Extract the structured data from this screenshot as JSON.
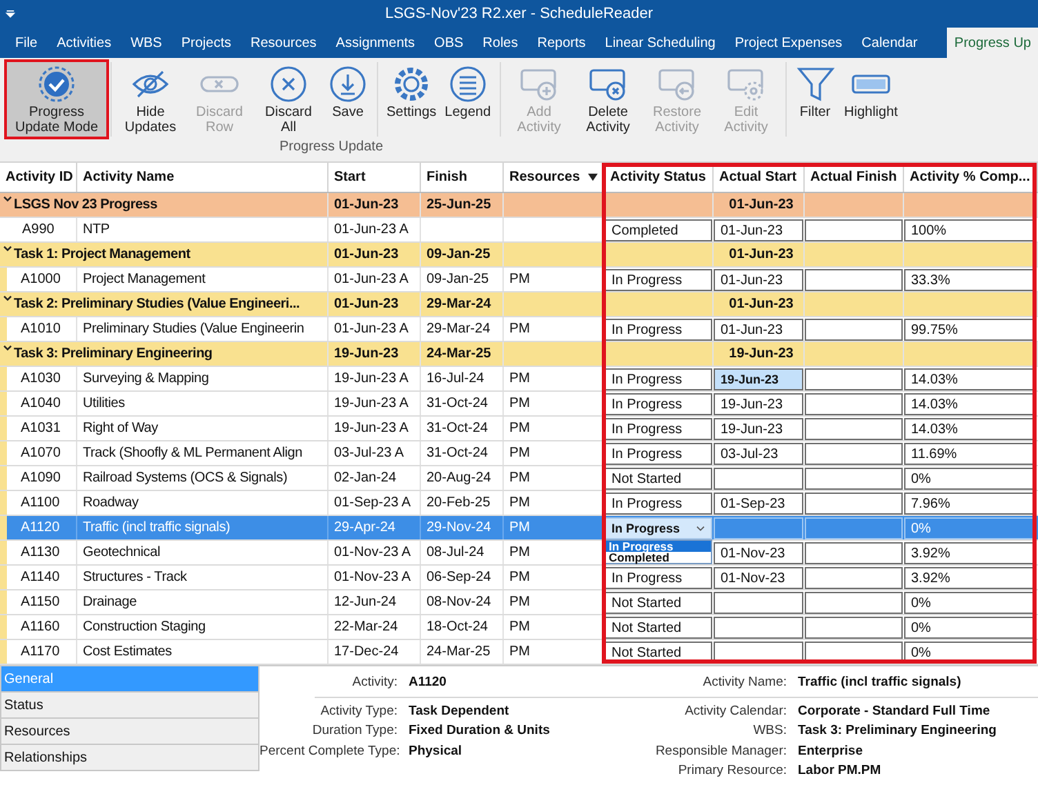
{
  "window": {
    "title": "LSGS-Nov'23 R2.xer - ScheduleReader"
  },
  "menu": [
    {
      "label": "File",
      "selected": false
    },
    {
      "label": "Activities",
      "selected": false
    },
    {
      "label": "WBS",
      "selected": false
    },
    {
      "label": "Projects",
      "selected": false
    },
    {
      "label": "Resources",
      "selected": false
    },
    {
      "label": "Assignments",
      "selected": false
    },
    {
      "label": "OBS",
      "selected": false
    },
    {
      "label": "Roles",
      "selected": false
    },
    {
      "label": "Reports",
      "selected": false
    },
    {
      "label": "Linear Scheduling",
      "selected": false
    },
    {
      "label": "Project Expenses",
      "selected": false
    },
    {
      "label": "Calendar",
      "selected": false
    },
    {
      "label": "Progress Up",
      "selected": true
    }
  ],
  "ribbon": {
    "caption": "Progress Update",
    "groups": [
      {
        "buttons": [
          {
            "label": "Progress Update Mode",
            "selected": true,
            "disabled": false
          }
        ]
      },
      {
        "buttons": [
          {
            "label": "Hide Updates",
            "selected": false,
            "disabled": false
          },
          {
            "label": "Discard Row",
            "selected": false,
            "disabled": true
          },
          {
            "label": "Discard All",
            "selected": false,
            "disabled": false
          },
          {
            "label": "Save",
            "selected": false,
            "disabled": false
          }
        ]
      },
      {
        "buttons": [
          {
            "label": "Settings",
            "selected": false,
            "disabled": false
          },
          {
            "label": "Legend",
            "selected": false,
            "disabled": false
          }
        ]
      },
      {
        "buttons": [
          {
            "label": "Add Activity",
            "selected": false,
            "disabled": true
          },
          {
            "label": "Delete Activity",
            "selected": false,
            "disabled": false
          },
          {
            "label": "Restore Activity",
            "selected": false,
            "disabled": true
          },
          {
            "label": "Edit Activity",
            "selected": false,
            "disabled": true
          }
        ]
      },
      {
        "buttons": [
          {
            "label": "Filter",
            "selected": false,
            "disabled": false
          },
          {
            "label": "Highlight",
            "selected": false,
            "disabled": false
          }
        ]
      }
    ]
  },
  "table": {
    "columns": [
      "Activity ID",
      "Activity Name",
      "Start",
      "Finish",
      "Resources",
      "Activity Status",
      "Actual Start",
      "Actual Finish",
      "Activity % Comp..."
    ],
    "rows": [
      {
        "kind": "project",
        "name": "LSGS Nov 23 Progress",
        "start": "01-Jun-23",
        "finish": "25-Jun-25",
        "actual_start": "01-Jun-23",
        "expanded": true,
        "children": [
          {
            "kind": "activity",
            "id": "A990",
            "name": "NTP",
            "start": "01-Jun-23 A",
            "status": "Completed",
            "actual_start": "01-Jun-23",
            "percent": "100%",
            "selected": false,
            "actual_start_focused": false
          },
          {
            "kind": "task",
            "name": "Task 1: Project Management",
            "start": "01-Jun-23",
            "finish": "09-Jan-25",
            "actual_start": "01-Jun-23",
            "expanded": true,
            "children": [
              {
                "kind": "activity",
                "id": "A1000",
                "name": "Project Management",
                "start": "01-Jun-23 A",
                "finish": "09-Jan-25",
                "resources": "PM",
                "status": "In Progress",
                "actual_start": "01-Jun-23",
                "percent": "33.3%",
                "selected": false,
                "actual_start_focused": false
              }
            ]
          },
          {
            "kind": "task",
            "name": "Task 2: Preliminary Studies (Value Engineeri...",
            "start": "01-Jun-23",
            "finish": "29-Mar-24",
            "actual_start": "01-Jun-23",
            "expanded": true,
            "children": [
              {
                "kind": "activity",
                "id": "A1010",
                "name": "Preliminary Studies (Value Engineerin",
                "start": "01-Jun-23 A",
                "finish": "29-Mar-24",
                "resources": "PM",
                "status": "In Progress",
                "actual_start": "01-Jun-23",
                "percent": "99.75%",
                "selected": false,
                "actual_start_focused": false
              }
            ]
          },
          {
            "kind": "task",
            "name": "Task 3: Preliminary Engineering",
            "start": "19-Jun-23",
            "finish": "24-Mar-25",
            "actual_start": "19-Jun-23",
            "expanded": true,
            "children": [
              {
                "kind": "activity",
                "id": "A1030",
                "name": "Surveying & Mapping",
                "start": "19-Jun-23 A",
                "finish": "16-Jul-24",
                "resources": "PM",
                "status": "In Progress",
                "actual_start": "19-Jun-23",
                "percent": "14.03%",
                "selected": false,
                "actual_start_focused": true
              },
              {
                "kind": "activity",
                "id": "A1040",
                "name": "Utilities",
                "start": "19-Jun-23 A",
                "finish": "31-Oct-24",
                "resources": "PM",
                "status": "In Progress",
                "actual_start": "19-Jun-23",
                "percent": "14.03%",
                "selected": false,
                "actual_start_focused": false
              },
              {
                "kind": "activity",
                "id": "A1031",
                "name": "Right of Way",
                "start": "19-Jun-23 A",
                "finish": "31-Oct-24",
                "resources": "PM",
                "status": "In Progress",
                "actual_start": "19-Jun-23",
                "percent": "14.03%",
                "selected": false,
                "actual_start_focused": false
              },
              {
                "kind": "activity",
                "id": "A1070",
                "name": "Track (Shoofly & ML Permanent Align",
                "start": "03-Jul-23 A",
                "finish": "31-Oct-24",
                "resources": "PM",
                "status": "In Progress",
                "actual_start": "03-Jul-23",
                "percent": "11.69%",
                "selected": false,
                "actual_start_focused": false
              },
              {
                "kind": "activity",
                "id": "A1090",
                "name": "Railroad Systems (OCS & Signals)",
                "start": "02-Jan-24",
                "finish": "20-Aug-24",
                "resources": "PM",
                "status": "Not Started",
                "percent": "0%",
                "selected": false,
                "actual_start_focused": false
              },
              {
                "kind": "activity",
                "id": "A1100",
                "name": "Roadway",
                "start": "01-Sep-23 A",
                "finish": "20-Feb-25",
                "resources": "PM",
                "status": "In Progress",
                "actual_start": "01-Sep-23",
                "percent": "7.96%",
                "selected": false,
                "actual_start_focused": false
              },
              {
                "kind": "activity",
                "id": "A1120",
                "name": "Traffic (incl traffic signals)",
                "start": "29-Apr-24",
                "finish": "29-Nov-24",
                "resources": "PM",
                "status": "In Progress",
                "status_dropdown": {
                  "open": true,
                  "options": [
                    {
                      "label": "In Progress",
                      "selected": true
                    },
                    {
                      "label": "Completed",
                      "selected": false
                    }
                  ]
                },
                "percent": "0%",
                "selected": true,
                "actual_start_focused": false
              },
              {
                "kind": "activity",
                "id": "A1130",
                "name": "Geotechnical",
                "start": "01-Nov-23 A",
                "finish": "08-Jul-24",
                "resources": "PM",
                "actual_start": "01-Nov-23",
                "percent": "3.92%",
                "selected": false,
                "actual_start_focused": false
              },
              {
                "kind": "activity",
                "id": "A1140",
                "name": "Structures - Track",
                "start": "01-Nov-23 A",
                "finish": "06-Sep-24",
                "resources": "PM",
                "status": "In Progress",
                "actual_start": "01-Nov-23",
                "percent": "3.92%",
                "selected": false,
                "actual_start_focused": false
              },
              {
                "kind": "activity",
                "id": "A1150",
                "name": "Drainage",
                "start": "12-Jun-24",
                "finish": "08-Nov-24",
                "resources": "PM",
                "status": "Not Started",
                "percent": "0%",
                "selected": false,
                "actual_start_focused": false
              },
              {
                "kind": "activity",
                "id": "A1160",
                "name": "Construction Staging",
                "start": "22-Mar-24",
                "finish": "18-Oct-24",
                "resources": "PM",
                "status": "Not Started",
                "percent": "0%",
                "selected": false,
                "actual_start_focused": false
              },
              {
                "kind": "activity",
                "id": "A1170",
                "name": "Cost Estimates",
                "start": "17-Dec-24",
                "finish": "24-Mar-25",
                "resources": "PM",
                "status": "Not Started",
                "percent": "0%",
                "selected": false,
                "actual_start_focused": false
              }
            ]
          }
        ]
      }
    ]
  },
  "detail_tabs": [
    {
      "label": "General",
      "selected": true
    },
    {
      "label": "Status",
      "selected": false
    },
    {
      "label": "Resources",
      "selected": false
    },
    {
      "label": "Relationships",
      "selected": false
    }
  ],
  "details": {
    "header": [
      {
        "label": "Activity:",
        "value": "A1120"
      },
      {
        "label": "Activity Name:",
        "value": "Traffic (incl traffic signals)"
      }
    ],
    "left": [
      {
        "label": "Activity Type:",
        "value": "Task Dependent"
      },
      {
        "label": "Duration Type:",
        "value": "Fixed Duration & Units"
      },
      {
        "label": "Percent Complete Type:",
        "value": "Physical"
      }
    ],
    "right": [
      {
        "label": "Activity Calendar:",
        "value": "Corporate - Standard Full Time"
      },
      {
        "label": "WBS:",
        "value": "Task 3: Preliminary Engineering"
      },
      {
        "label": "Responsible Manager:",
        "value": "Enterprise"
      },
      {
        "label": "Primary Resource:",
        "value": "Labor PM.PM"
      }
    ]
  }
}
